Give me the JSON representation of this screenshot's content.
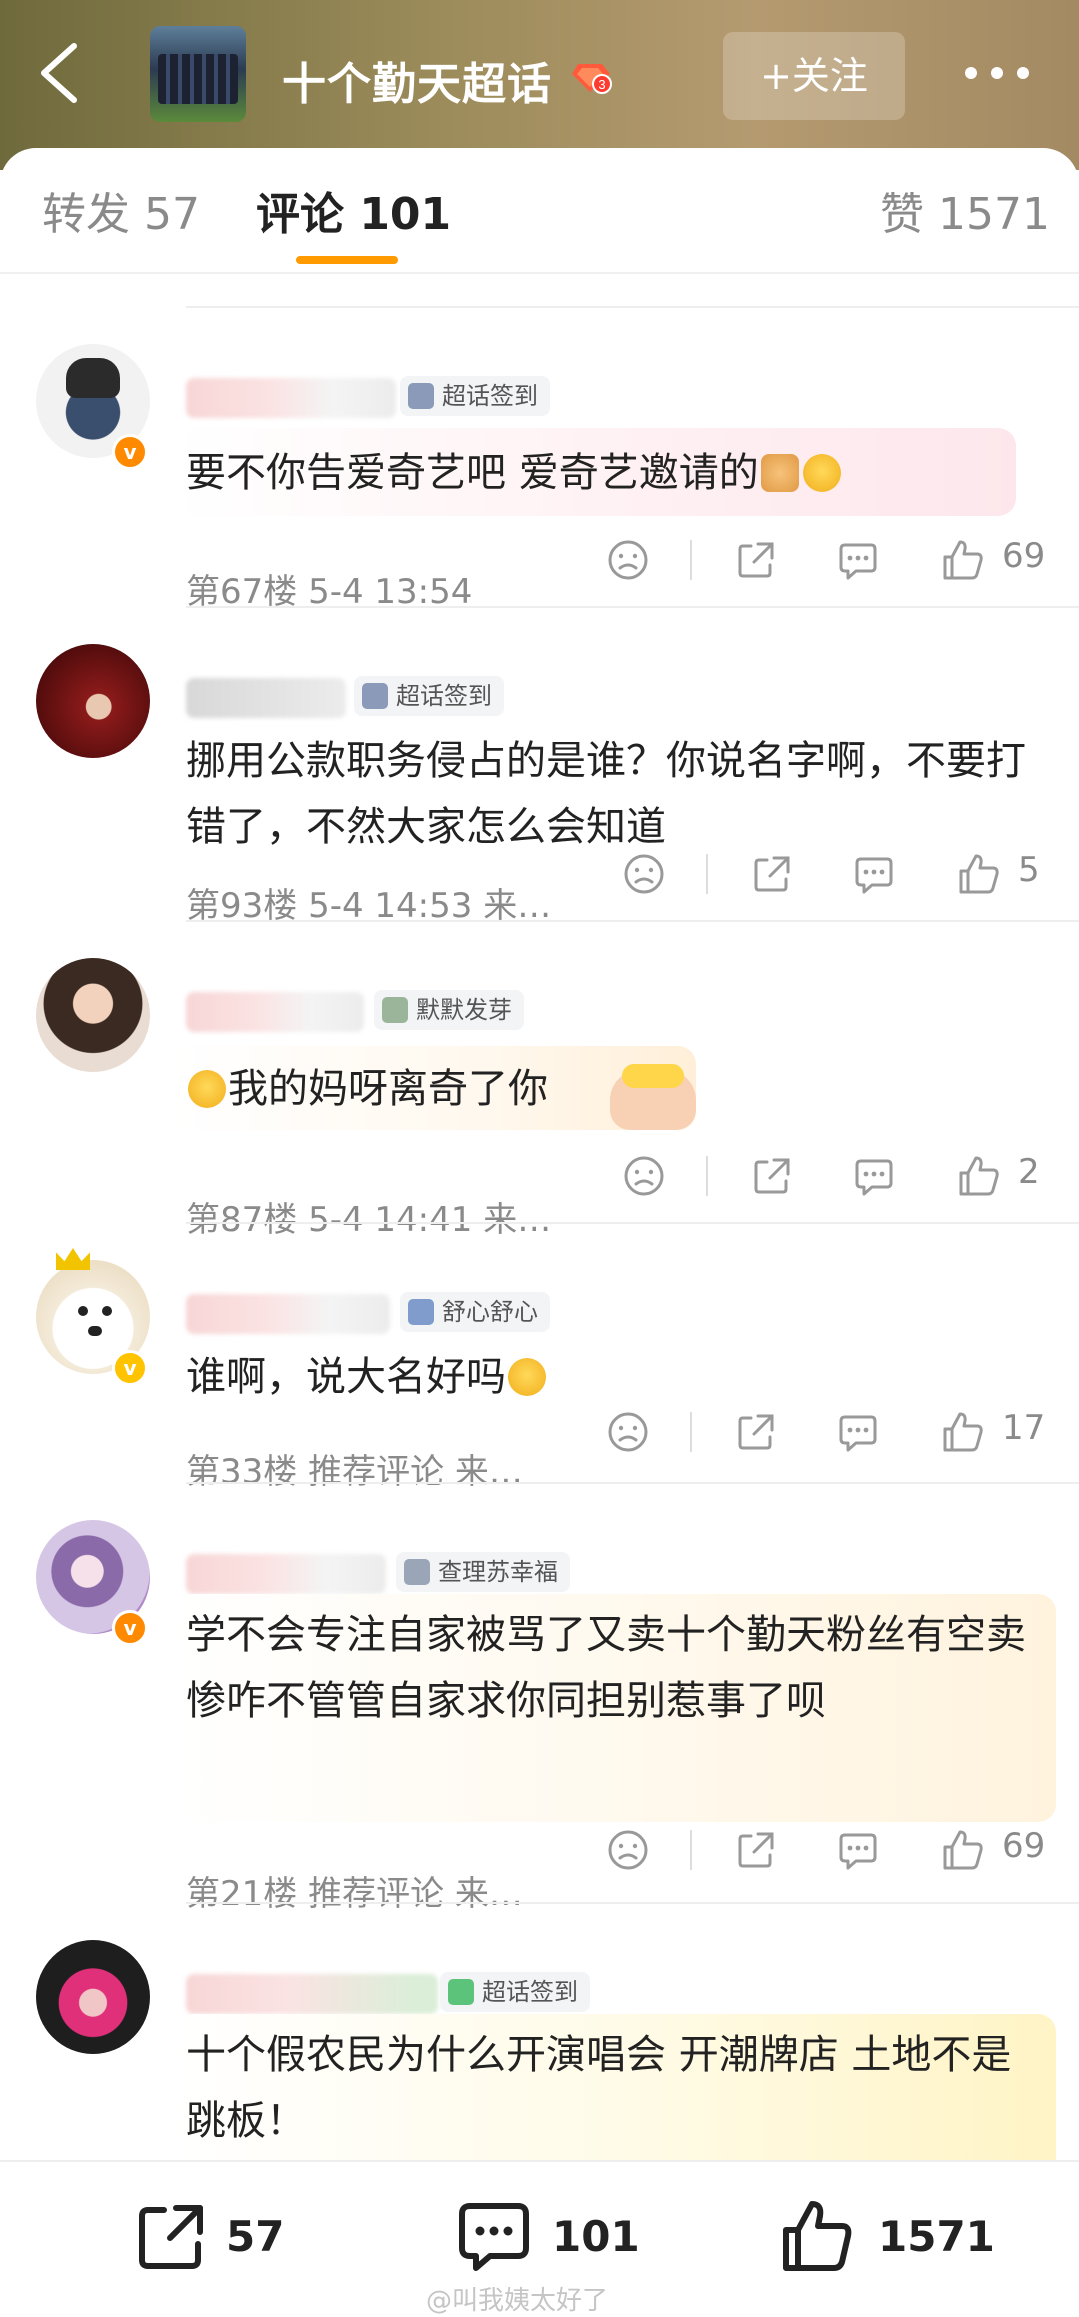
{
  "header": {
    "title": "十个勤天超话",
    "level": "3",
    "follow_label": "+关注",
    "bg_color": "#8f7f52"
  },
  "tabs": [
    {
      "label": "转发 57",
      "active": false
    },
    {
      "label": "评论 101",
      "active": true
    },
    {
      "label": "赞 1571",
      "active": false
    }
  ],
  "accent_color": "#ff9b00",
  "comments": [
    {
      "tag": "超话签到",
      "tag_icon": "checkin-icon",
      "content": "要不你告爱奇艺吧 爱奇艺邀请的",
      "floor": "第67楼",
      "time": "5-4 13:54",
      "likes": "69",
      "verified": true
    },
    {
      "tag": "超话签到",
      "tag_icon": "checkin-icon",
      "content": "挪用公款职务侵占的是谁？你说名字啊，不要打错了，不然大家怎么会知道",
      "floor": "第93楼",
      "time": "5-4 14:53",
      "source": "来…",
      "likes": "5",
      "verified": false
    },
    {
      "tag": "默默发芽",
      "tag_icon": "sprout-icon",
      "content": "我的妈呀离奇了你",
      "floor": "第87楼",
      "time": "5-4 14:41",
      "source": "来…",
      "likes": "2",
      "verified": false
    },
    {
      "tag": "舒心舒心",
      "tag_icon": "fish-icon",
      "content": "谁啊，说大名好吗",
      "floor": "第33楼",
      "time": "推荐评论",
      "source": "来…",
      "likes": "17",
      "verified": true
    },
    {
      "tag": "查理苏幸福",
      "tag_icon": "folder-icon",
      "content": "学不会专注自家被骂了又卖十个勤天粉丝有空卖惨咋不管管自家求你同担别惹事了呗",
      "floor": "第21楼",
      "time": "推荐评论",
      "source": "来…",
      "likes": "69",
      "verified": true
    },
    {
      "tag": "超话签到",
      "tag_icon": "checkin-green-icon",
      "content": "十个假农民为什么开演唱会 开潮牌店 土地不是跳板！",
      "verified": false
    }
  ],
  "bottom_bar": {
    "reposts": "57",
    "comments": "101",
    "likes": "1571"
  },
  "watermark": "@叫我姨太好了"
}
